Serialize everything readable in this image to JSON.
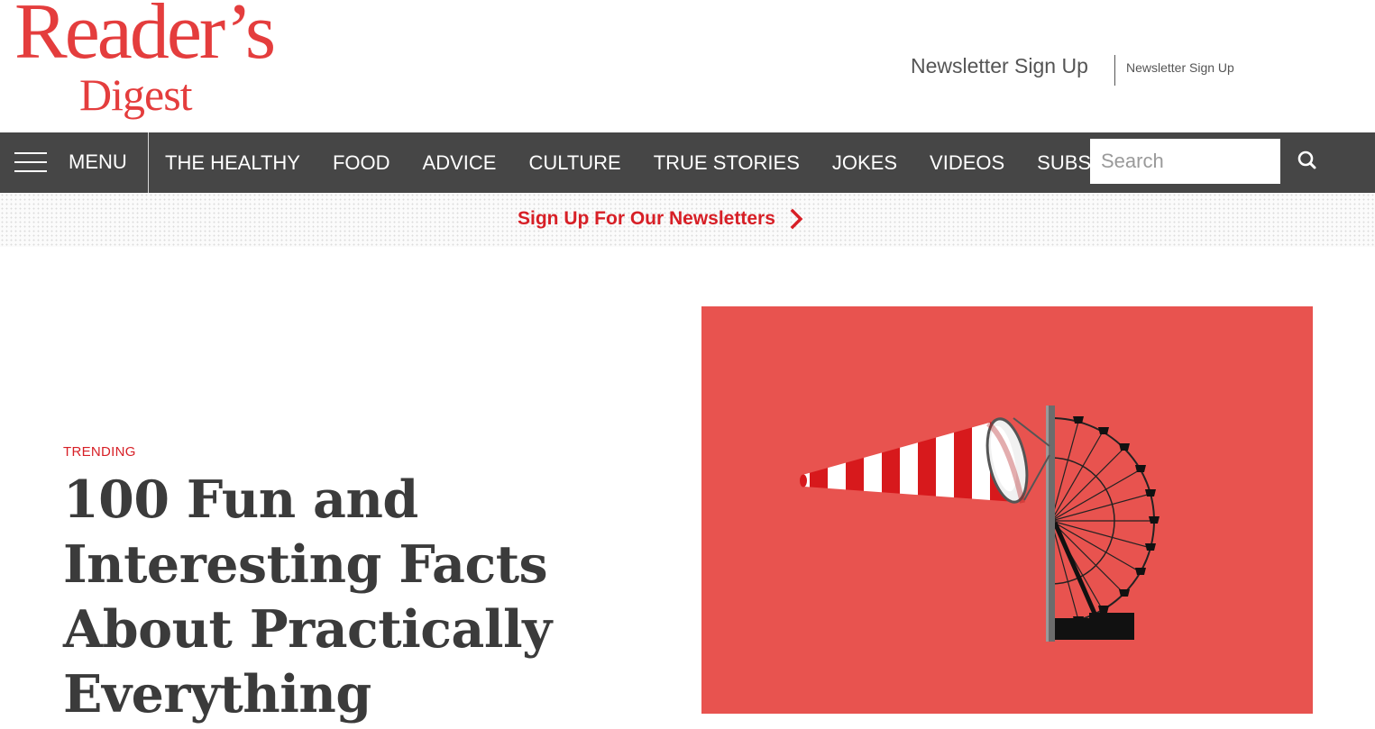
{
  "header": {
    "logo_line1": "Reader’s",
    "logo_line2": "Digest",
    "newsletter_large": "Newsletter Sign Up",
    "newsletter_small": "Newsletter Sign Up"
  },
  "nav": {
    "menu_label": "MENU",
    "links": [
      "THE HEALTHY",
      "FOOD",
      "ADVICE",
      "CULTURE",
      "TRUE STORIES",
      "JOKES",
      "VIDEOS",
      "SUBSCRIBE"
    ],
    "search_placeholder": "Search"
  },
  "banner": {
    "text": "Sign Up For Our Newsletters"
  },
  "hero": {
    "tag": "TRENDING",
    "headline": "100 Fun and Interesting Facts About Practically Everything"
  },
  "icons": {
    "menu": "hamburger-icon",
    "search": "search-icon",
    "chevron": "chevron-right-icon"
  },
  "colors": {
    "brand_red": "#e43d3d",
    "link_red": "#d71f26",
    "nav_bg": "#464646",
    "hero_bg": "#e8534f"
  }
}
